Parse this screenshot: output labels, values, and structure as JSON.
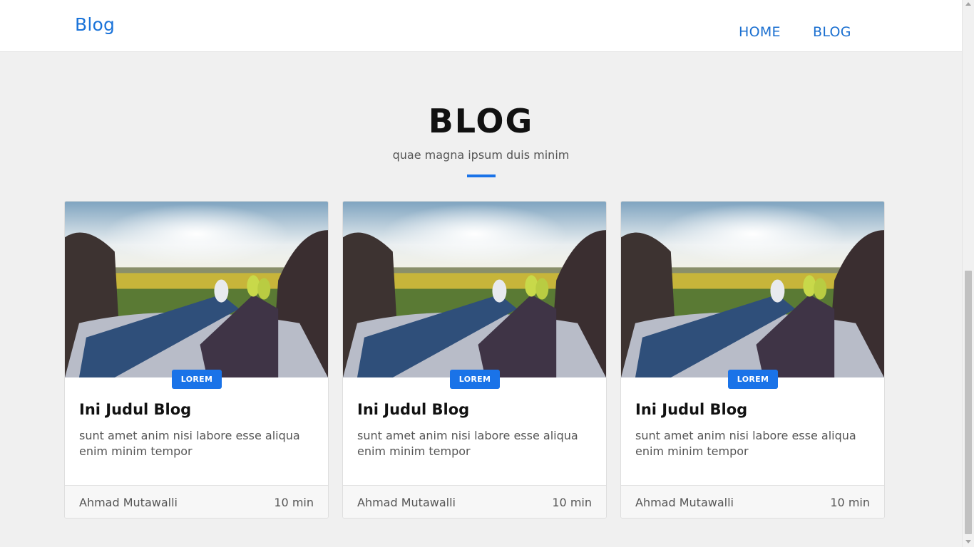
{
  "navbar": {
    "brand": "Blog",
    "links": [
      {
        "label": "HOME"
      },
      {
        "label": "BLOG"
      }
    ]
  },
  "section": {
    "title": "BLOG",
    "subtitle": "quae magna ipsum duis minim"
  },
  "posts": [
    {
      "badge": "LOREM",
      "title": "Ini Judul Blog",
      "excerpt": "sunt amet anim nisi labore esse aliqua enim minim tempor",
      "author": "Ahmad Mutawalli",
      "duration": "10 min",
      "image": "couple-feet-car-trunk-field-sunset-photo"
    },
    {
      "badge": "LOREM",
      "title": "Ini Judul Blog",
      "excerpt": "sunt amet anim nisi labore esse aliqua enim minim tempor",
      "author": "Ahmad Mutawalli",
      "duration": "10 min",
      "image": "couple-feet-car-trunk-field-sunset-photo"
    },
    {
      "badge": "LOREM",
      "title": "Ini Judul Blog",
      "excerpt": "sunt amet anim nisi labore esse aliqua enim minim tempor",
      "author": "Ahmad Mutawalli",
      "duration": "10 min",
      "image": "couple-feet-car-trunk-field-sunset-photo"
    }
  ],
  "colors": {
    "accent": "#1a73e8",
    "background": "#f0f0f0",
    "card": "#ffffff"
  }
}
